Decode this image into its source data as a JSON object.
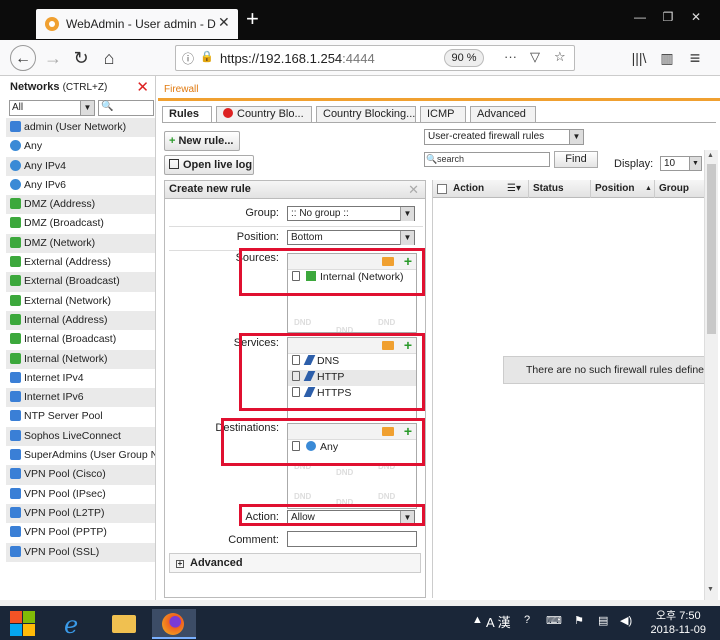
{
  "browser": {
    "tab_title": "WebAdmin - User admin - De",
    "url_main": "https://192.168.1.254",
    "url_port": ":4444",
    "zoom": "90 %"
  },
  "networks_panel": {
    "title": "Networks",
    "hint": "(CTRL+Z)",
    "filter_value": "All",
    "items": [
      {
        "label": "admin (User Network)",
        "icon": "blue"
      },
      {
        "label": "Any",
        "icon": "globe"
      },
      {
        "label": "Any IPv4",
        "icon": "globe"
      },
      {
        "label": "Any IPv6",
        "icon": "globe"
      },
      {
        "label": "DMZ (Address)",
        "icon": "green"
      },
      {
        "label": "DMZ (Broadcast)",
        "icon": "green"
      },
      {
        "label": "DMZ (Network)",
        "icon": "green"
      },
      {
        "label": "External (Address)",
        "icon": "green"
      },
      {
        "label": "External (Broadcast)",
        "icon": "green"
      },
      {
        "label": "External (Network)",
        "icon": "green"
      },
      {
        "label": "Internal (Address)",
        "icon": "green"
      },
      {
        "label": "Internal (Broadcast)",
        "icon": "green"
      },
      {
        "label": "Internal (Network)",
        "icon": "green"
      },
      {
        "label": "Internet IPv4",
        "icon": "blue"
      },
      {
        "label": "Internet IPv6",
        "icon": "blue"
      },
      {
        "label": "NTP Server Pool",
        "icon": "blue"
      },
      {
        "label": "Sophos LiveConnect",
        "icon": "blue"
      },
      {
        "label": "SuperAdmins (User Group Ne",
        "icon": "blue"
      },
      {
        "label": "VPN Pool (Cisco)",
        "icon": "blue"
      },
      {
        "label": "VPN Pool (IPsec)",
        "icon": "blue"
      },
      {
        "label": "VPN Pool (L2TP)",
        "icon": "blue"
      },
      {
        "label": "VPN Pool (PPTP)",
        "icon": "blue"
      },
      {
        "label": "VPN Pool (SSL)",
        "icon": "blue"
      }
    ]
  },
  "main": {
    "breadcrumb": "Firewall",
    "tabs": [
      {
        "label": "Rules",
        "active": true
      },
      {
        "label": "Country Blo...",
        "active": false,
        "blocked": true
      },
      {
        "label": "Country Blocking...",
        "active": false
      },
      {
        "label": "ICMP",
        "active": false
      },
      {
        "label": "Advanced",
        "active": false
      }
    ],
    "new_rule_label": "New rule...",
    "open_live_log_label": "Open live log",
    "filter_select": "User-created firewall rules",
    "search_placeholder": "search",
    "find_label": "Find",
    "display_label": "Display:",
    "display_value": "10"
  },
  "create_rule": {
    "title": "Create new rule",
    "group_label": "Group:",
    "group_value": ":: No group ::",
    "position_label": "Position:",
    "position_value": "Bottom",
    "sources_label": "Sources:",
    "sources": [
      "Internal (Network)"
    ],
    "services_label": "Services:",
    "services": [
      "DNS",
      "HTTP",
      "HTTPS"
    ],
    "destinations_label": "Destinations:",
    "destinations": [
      "Any"
    ],
    "action_label": "Action:",
    "action_value": "Allow",
    "comment_label": "Comment:",
    "advanced_label": "Advanced",
    "dnd": "DND"
  },
  "rules_table": {
    "columns": [
      "Action",
      "Status",
      "Position",
      "Group"
    ],
    "empty_message": "There are no such firewall rules defined"
  },
  "taskbar": {
    "ime": "A 漢",
    "time": "오후 7:50",
    "date": "2018-11-09"
  },
  "colors": {
    "accent_orange": "#f0a030",
    "highlight_red": "#e01030",
    "add_green": "#2a9a2a"
  }
}
